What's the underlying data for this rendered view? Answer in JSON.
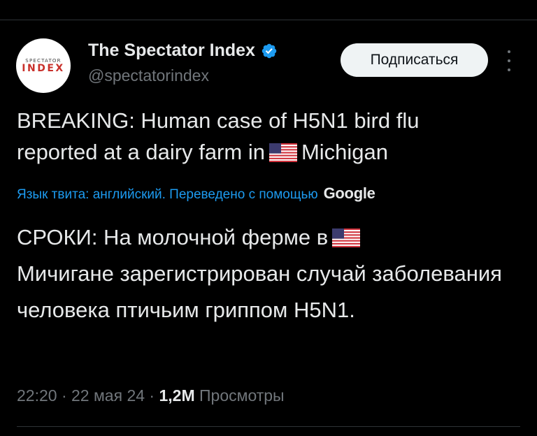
{
  "author": {
    "avatar_top": "SPECTATOR",
    "avatar_bottom": "INDEX",
    "display_name": "The Spectator Index",
    "handle": "@spectatorindex",
    "verified_icon": "verified-badge-icon",
    "verified_color": "#1d9bf0"
  },
  "actions": {
    "subscribe_label": "Подписаться",
    "more_icon": "vertical-dots-icon"
  },
  "tweet": {
    "line1": "BREAKING: Human case of H5N1 bird flu",
    "line2_before_flag": "reported at a dairy farm in",
    "line2_after_flag": "Michigan",
    "flag": "us-flag"
  },
  "translation": {
    "label": "Язык твита: английский. Переведено с помощью",
    "provider": "Google",
    "text_before_flag": "СРОКИ: На молочной ферме в",
    "text_after_flag": "Мичигане зарегистрирован случай заболевания человека птичьим гриппом H5N1."
  },
  "meta": {
    "time": "22:20",
    "date": "22 мая 24",
    "views_count": "1,2M",
    "views_label": "Просмотры",
    "separator": "·"
  },
  "colors": {
    "background": "#000000",
    "text": "#e7e9ea",
    "secondary": "#71767b",
    "link": "#1d9bf0",
    "button_bg": "#eff3f4"
  }
}
